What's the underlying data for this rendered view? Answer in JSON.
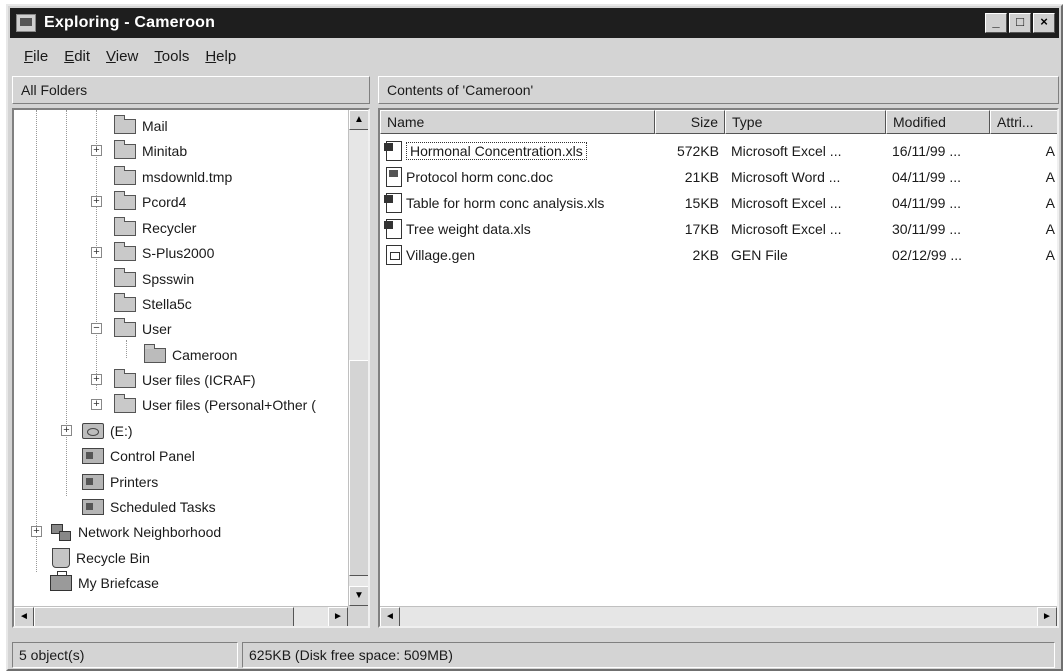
{
  "window": {
    "title": "Exploring - Cameroon"
  },
  "window_buttons": {
    "minimize": "_",
    "maximize": "□",
    "close": "×"
  },
  "menu": [
    {
      "label_acc": "F",
      "label_rest": "ile"
    },
    {
      "label_acc": "E",
      "label_rest": "dit"
    },
    {
      "label_acc": "V",
      "label_rest": "iew"
    },
    {
      "label_acc": "T",
      "label_rest": "ools"
    },
    {
      "label_acc": "H",
      "label_rest": "elp"
    }
  ],
  "left_header": "All Folders",
  "right_header": "Contents of 'Cameroon'",
  "tree": [
    {
      "label": "Mail",
      "icon": "folder-icon"
    },
    {
      "label": "Minitab",
      "icon": "folder-icon",
      "expander": "+"
    },
    {
      "label": "msdownld.tmp",
      "icon": "folder-icon"
    },
    {
      "label": "Pcord4",
      "icon": "folder-icon",
      "expander": "+"
    },
    {
      "label": "Recycler",
      "icon": "folder-icon"
    },
    {
      "label": "S-Plus2000",
      "icon": "folder-icon",
      "expander": "+"
    },
    {
      "label": "Spsswin",
      "icon": "folder-icon"
    },
    {
      "label": "Stella5c",
      "icon": "folder-icon"
    },
    {
      "label": "User",
      "icon": "folder-icon",
      "expander": "−"
    },
    {
      "label": "Cameroon",
      "icon": "open-folder-icon"
    },
    {
      "label": "User files (ICRAF)",
      "icon": "folder-icon",
      "expander": "+"
    },
    {
      "label": "User files (Personal+Other (",
      "icon": "folder-icon",
      "expander": "+"
    },
    {
      "label": "(E:)",
      "icon": "drive-icon",
      "expander": "+"
    },
    {
      "label": "Control Panel",
      "icon": "control-panel-icon"
    },
    {
      "label": "Printers",
      "icon": "printers-icon"
    },
    {
      "label": "Scheduled Tasks",
      "icon": "scheduled-tasks-icon"
    },
    {
      "label": "Network Neighborhood",
      "icon": "network-icon",
      "expander": "+"
    },
    {
      "label": "Recycle Bin",
      "icon": "recycle-bin-icon"
    },
    {
      "label": "My Briefcase",
      "icon": "briefcase-icon"
    }
  ],
  "columns": [
    "Name",
    "Size",
    "Type",
    "Modified",
    "Attri..."
  ],
  "files": [
    {
      "name": "Hormonal Concentration.xls",
      "size": "572KB",
      "type": "Microsoft Excel ...",
      "modified": "16/11/99 ...",
      "attr": "A",
      "icon": "xls"
    },
    {
      "name": "Protocol horm conc.doc",
      "size": "21KB",
      "type": "Microsoft Word ...",
      "modified": "04/11/99 ...",
      "attr": "A",
      "icon": "doc"
    },
    {
      "name": "Table for horm conc analysis.xls",
      "size": "15KB",
      "type": "Microsoft Excel ...",
      "modified": "04/11/99 ...",
      "attr": "A",
      "icon": "xls"
    },
    {
      "name": "Tree weight data.xls",
      "size": "17KB",
      "type": "Microsoft Excel ...",
      "modified": "30/11/99 ...",
      "attr": "A",
      "icon": "xls"
    },
    {
      "name": "Village.gen",
      "size": "2KB",
      "type": "GEN File",
      "modified": "02/12/99 ...",
      "attr": "A",
      "icon": "gen"
    }
  ],
  "scroll_glyphs": {
    "up": "▲",
    "down": "▼",
    "left": "◄",
    "right": "►"
  },
  "status": {
    "objects": "5 object(s)",
    "space": "625KB (Disk free space: 509MB)"
  }
}
